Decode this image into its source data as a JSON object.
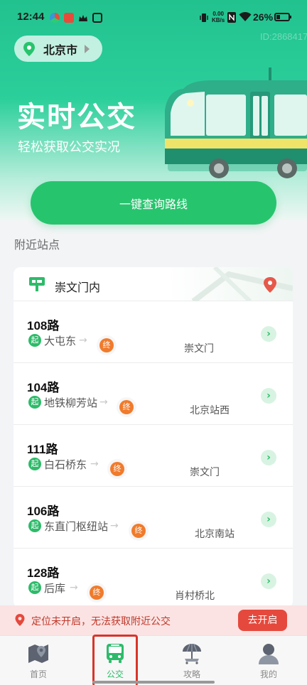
{
  "status_bar": {
    "time": "12:44",
    "net_speed_value": "0.00",
    "net_speed_unit": "KB/s",
    "battery": "26%"
  },
  "header": {
    "city": "北京市",
    "watermark": "ID:2868417",
    "title": "实时公交",
    "subtitle": "轻松获取公交实况",
    "query_button": "一键查询路线"
  },
  "nearby": {
    "section_title": "附近站点",
    "stop_name": "崇文门内",
    "start_badge": "起",
    "end_badge": "终",
    "arrow": "→",
    "go": "›",
    "routes": [
      {
        "name": "108路",
        "from": "大屯东",
        "to": "崇文门"
      },
      {
        "name": "104路",
        "from": "地铁柳芳站",
        "to": "北京站西"
      },
      {
        "name": "111路",
        "from": "白石桥东",
        "to": "崇文门"
      },
      {
        "name": "106路",
        "from": "东直门枢纽站",
        "to": "北京南站"
      },
      {
        "name": "128路",
        "from": "后库",
        "to": "肖村桥北"
      }
    ]
  },
  "location_bar": {
    "message": "定位未开启，无法获取附近公交",
    "button": "去开启"
  },
  "tabs": [
    {
      "label": "首页",
      "icon": "map-icon"
    },
    {
      "label": "公交",
      "icon": "bus-icon",
      "active": true
    },
    {
      "label": "攻略",
      "icon": "umbrella-beach-icon"
    },
    {
      "label": "我的",
      "icon": "person-icon"
    }
  ],
  "colors": {
    "brand_green": "#27c46e",
    "start_green": "#2dbb6a",
    "end_orange": "#f07b2c",
    "alert_red": "#e5493d"
  }
}
